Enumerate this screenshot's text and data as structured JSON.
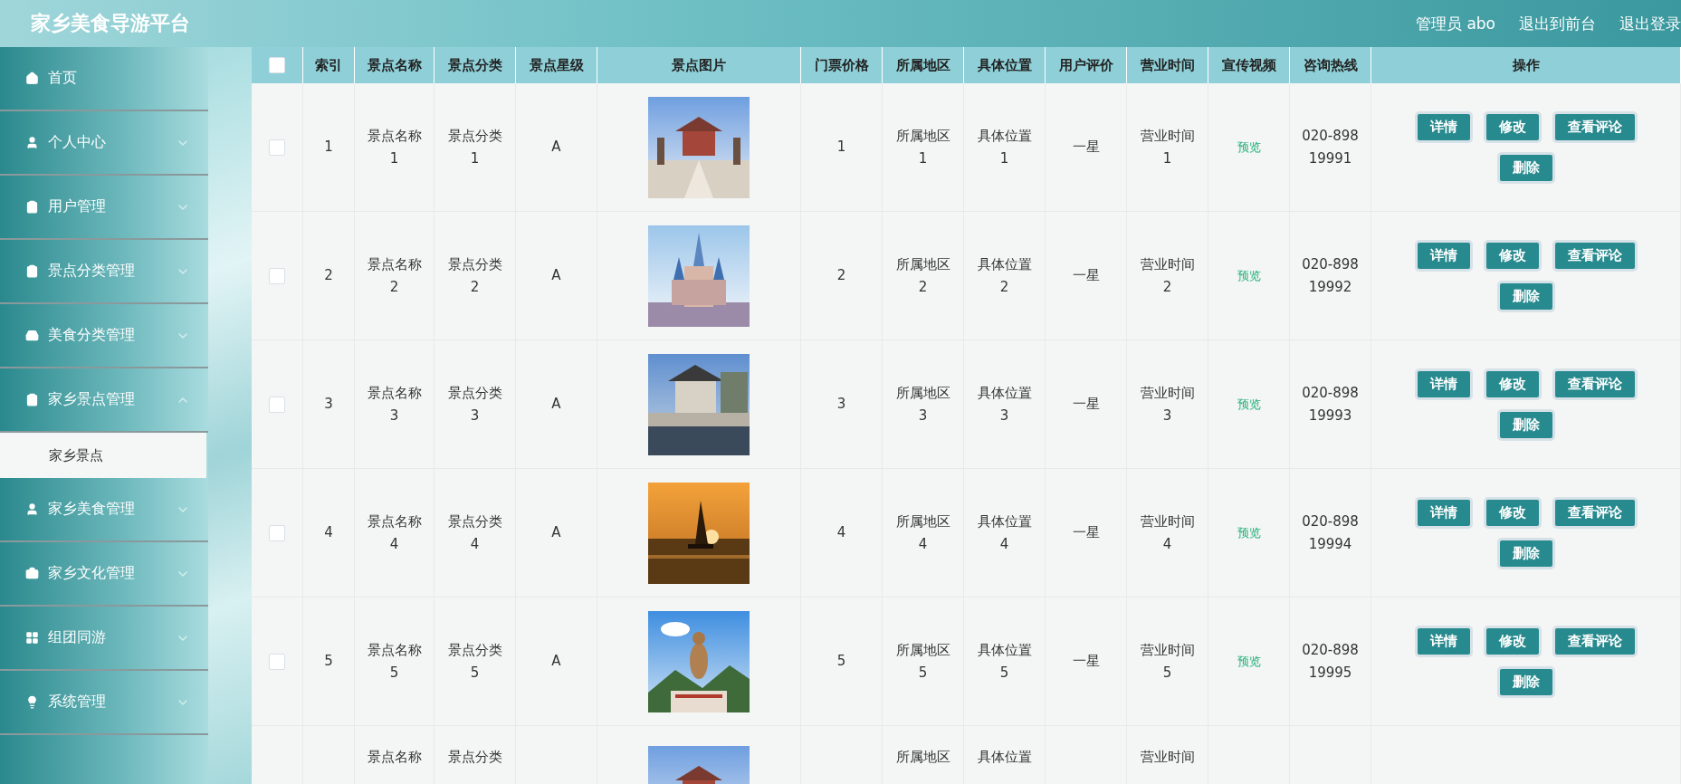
{
  "topbar": {
    "title": "家乡美食导游平台",
    "links": [
      "管理员 abo",
      "退出到前台",
      "退出登录"
    ]
  },
  "sidebar": {
    "items": [
      {
        "label": "首页"
      },
      {
        "label": "个人中心",
        "expanded": false
      },
      {
        "label": "用户管理",
        "expanded": false
      },
      {
        "label": "景点分类管理",
        "expanded": false
      },
      {
        "label": "美食分类管理",
        "expanded": false
      },
      {
        "label": "家乡景点管理",
        "expanded": true,
        "children": [
          {
            "label": "家乡景点",
            "selected": true
          }
        ]
      },
      {
        "label": "家乡美食管理",
        "expanded": false
      },
      {
        "label": "家乡文化管理",
        "expanded": false
      },
      {
        "label": "组团同游",
        "expanded": false
      },
      {
        "label": "系统管理",
        "expanded": false
      }
    ]
  },
  "table": {
    "select_all": {
      "checked": false
    },
    "columns": [
      "索引",
      "景点名称",
      "景点分类",
      "景点星级",
      "景点图片",
      "门票价格",
      "所属地区",
      "具体位置",
      "用户评价",
      "营业时间",
      "宣传视频",
      "咨询热线",
      "操作"
    ],
    "rows": [
      {
        "checked": false,
        "cells": [
          "1",
          "景点名称\n1",
          "景点分类\n1",
          "A",
          null,
          "1",
          "所属地区\n1",
          "具体位置\n1",
          "一星",
          "营业时间\n1"
        ],
        "video": "预览",
        "hotline": "020-898\n19991",
        "actions": [
          "详情",
          "修改",
          "查看评论",
          "删除"
        ]
      },
      {
        "checked": false,
        "cells": [
          "2",
          "景点名称\n2",
          "景点分类\n2",
          "A",
          null,
          "2",
          "所属地区\n2",
          "具体位置\n2",
          "一星",
          "营业时间\n2"
        ],
        "video": "预览",
        "hotline": "020-898\n19992",
        "actions": [
          "详情",
          "修改",
          "查看评论",
          "删除"
        ]
      },
      {
        "checked": false,
        "cells": [
          "3",
          "景点名称\n3",
          "景点分类\n3",
          "A",
          null,
          "3",
          "所属地区\n3",
          "具体位置\n3",
          "一星",
          "营业时间\n3"
        ],
        "video": "预览",
        "hotline": "020-898\n19993",
        "actions": [
          "详情",
          "修改",
          "查看评论",
          "删除"
        ]
      },
      {
        "checked": false,
        "cells": [
          "4",
          "景点名称\n4",
          "景点分类\n4",
          "A",
          null,
          "4",
          "所属地区\n4",
          "具体位置\n4",
          "一星",
          "营业时间\n4"
        ],
        "video": "预览",
        "hotline": "020-898\n19994",
        "actions": [
          "详情",
          "修改",
          "查看评论",
          "删除"
        ]
      },
      {
        "checked": false,
        "cells": [
          "5",
          "景点名称\n5",
          "景点分类\n5",
          "A",
          null,
          "5",
          "所属地区\n5",
          "具体位置\n5",
          "一星",
          "营业时间\n5"
        ],
        "video": "预览",
        "hotline": "020-898\n19995",
        "actions": [
          "详情",
          "修改",
          "查看评论",
          "删除"
        ]
      },
      {
        "cells": [
          "",
          "景点名称",
          "景点分类",
          "",
          null,
          "",
          "所属地区",
          "具体位置",
          "",
          "营业时间"
        ]
      }
    ]
  }
}
